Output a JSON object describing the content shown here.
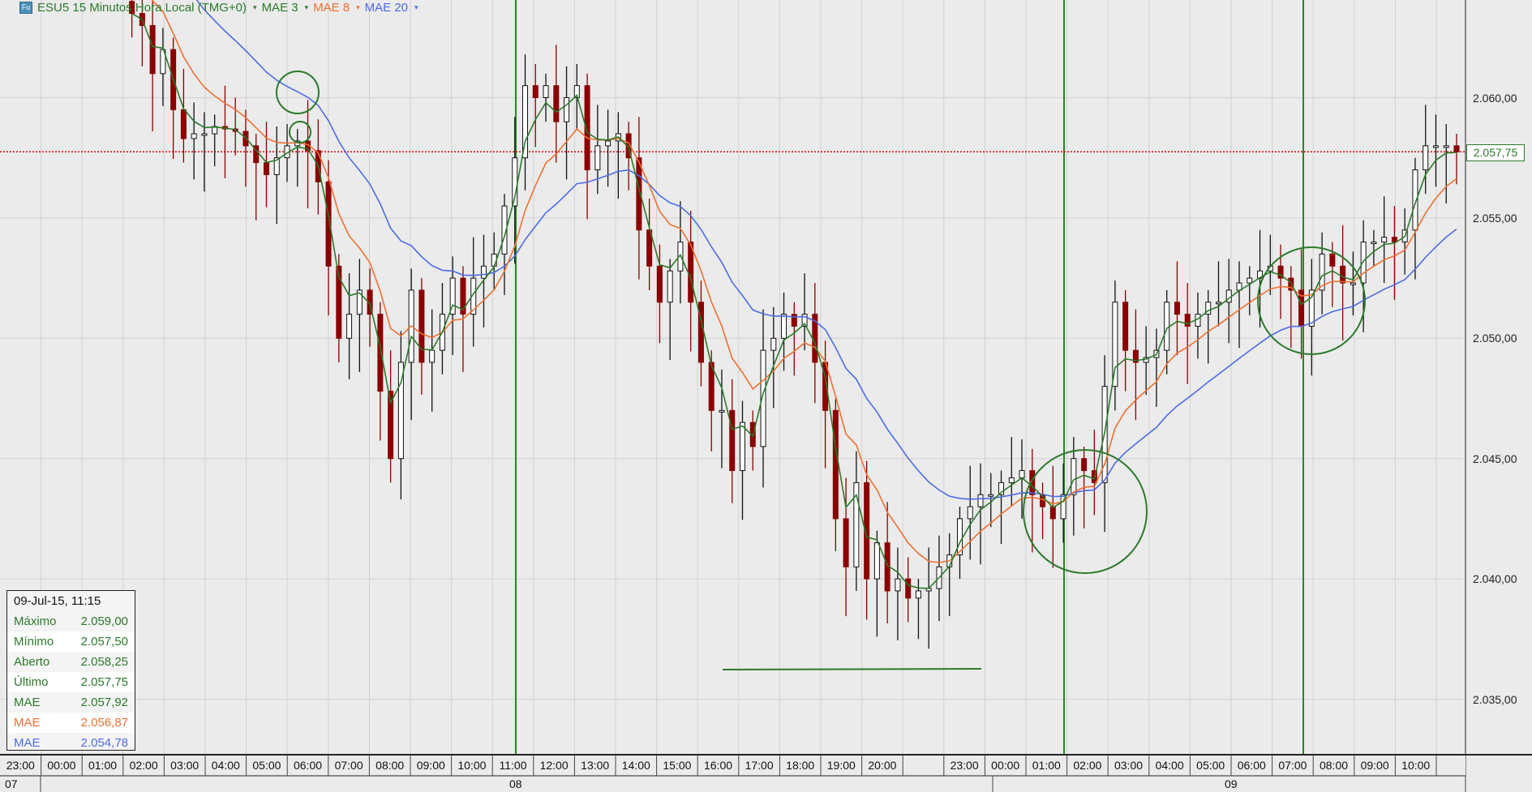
{
  "legend": {
    "icon_label": "Fu",
    "title": "ESU5 15 Minutos Hora Local (TMG+0)",
    "mae3": "MAE 3",
    "mae8": "MAE 8",
    "mae20": "MAE 20"
  },
  "colors": {
    "mae3": "#2b7a2b",
    "mae8": "#f07030",
    "mae20": "#4d6ce6",
    "down": "#8b0000",
    "up": "#ffffff",
    "last_line": "#e00000"
  },
  "y_axis": {
    "labels": [
      "2.060,00",
      "2.055,00",
      "2.050,00",
      "2.045,00",
      "2.040,00",
      "2.035,00"
    ],
    "values": [
      2060,
      2055,
      2050,
      2045,
      2040,
      2035
    ],
    "current_price": "2.057,75",
    "current_value": 2057.75
  },
  "x_axis": {
    "hours": [
      "23:00",
      "00:00",
      "01:00",
      "02:00",
      "03:00",
      "04:00",
      "05:00",
      "06:00",
      "07:00",
      "08:00",
      "09:00",
      "10:00",
      "11:00",
      "12:00",
      "13:00",
      "14:00",
      "15:00",
      "16:00",
      "17:00",
      "18:00",
      "19:00",
      "20:00",
      "",
      "23:00",
      "00:00",
      "01:00",
      "02:00",
      "03:00",
      "04:00",
      "05:00",
      "06:00",
      "07:00",
      "08:00",
      "09:00",
      "10:00"
    ],
    "dates": [
      "07",
      "08",
      "09"
    ]
  },
  "info": {
    "header": "09-Jul-15, 11:15",
    "rows": [
      {
        "label": "Máximo",
        "value": "2.059,00",
        "series": "g"
      },
      {
        "label": "Mínimo",
        "value": "2.057,50",
        "series": "g"
      },
      {
        "label": "Aberto",
        "value": "2.058,25",
        "series": "g"
      },
      {
        "label": "Último",
        "value": "2.057,75",
        "series": "g"
      },
      {
        "label": "MAE",
        "value": "2.057,92",
        "series": "g"
      },
      {
        "label": "MAE",
        "value": "2.056,87",
        "series": "o"
      },
      {
        "label": "MAE",
        "value": "2.054,78",
        "series": "b"
      }
    ]
  },
  "chart_data": {
    "type": "candlestick",
    "instrument": "ESU5",
    "interval": "15 Minutos",
    "ylim": [
      2032.3,
      2064
    ],
    "first_open": 2064,
    "mae_seed": {
      "mae3": 2063.5,
      "mae8": 2066,
      "mae20": 2068
    },
    "closes": [
      2063.5,
      2063,
      2061,
      2062,
      2059.5,
      2058.3,
      2058.5,
      2058.5,
      2058.8,
      2058.7,
      2058.6,
      2058,
      2057.3,
      2056.8,
      2057.5,
      2058,
      2058.2,
      2057.8,
      2056.5,
      2053,
      2050,
      2051,
      2052,
      2051,
      2047.8,
      2045,
      2049,
      2052,
      2049,
      2049.5,
      2051,
      2052.5,
      2051,
      2052.5,
      2053,
      2053.5,
      2055.5,
      2057.5,
      2060.5,
      2060,
      2060.5,
      2059,
      2060,
      2060.5,
      2057,
      2058,
      2058.2,
      2058.5,
      2057.5,
      2054.5,
      2053,
      2051.5,
      2052.8,
      2054,
      2051.5,
      2049,
      2047,
      2047,
      2044.5,
      2046.5,
      2045.5,
      2049.5,
      2050,
      2051,
      2050.5,
      2051,
      2049,
      2047,
      2042.5,
      2040.5,
      2044,
      2040,
      2041.5,
      2039.5,
      2040,
      2039.2,
      2039.5,
      2039.6,
      2040.5,
      2041,
      2042.5,
      2043,
      2043.5,
      2043.5,
      2044,
      2044.2,
      2044.5,
      2043.5,
      2043,
      2042.5,
      2043.5,
      2045,
      2044.5,
      2044,
      2048,
      2051.5,
      2049.5,
      2049,
      2049.2,
      2049.5,
      2051.5,
      2051,
      2050.5,
      2051,
      2051.5,
      2051.5,
      2052,
      2052.3,
      2052.5,
      2052.8,
      2053,
      2052.5,
      2052,
      2050.5,
      2052,
      2053.5,
      2053,
      2052.3,
      2052.3,
      2054,
      2054,
      2054.2,
      2054,
      2054.5,
      2057,
      2058,
      2058,
      2058,
      2057.75
    ]
  }
}
